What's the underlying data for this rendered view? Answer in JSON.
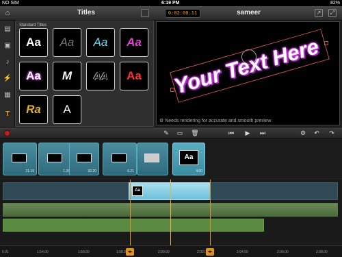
{
  "status": {
    "carrier": "NO SIM",
    "time": "6:19 PM",
    "battery": "82%"
  },
  "header": {
    "panel_title": "Titles",
    "timecode": "0:02:00.11",
    "project_name": "sameer"
  },
  "titles": {
    "section_label": "Standard Titles",
    "tiles": [
      {
        "label": "Aa",
        "color": "#ffffff",
        "style": "bold"
      },
      {
        "label": "Aa",
        "color": "#888888",
        "style": "script-outline"
      },
      {
        "label": "Aa",
        "color": "#6fd8f0",
        "style": "script"
      },
      {
        "label": "Aa",
        "color": "#e040d0",
        "style": "bold-italic"
      },
      {
        "label": "Aa",
        "color": "#ffffff",
        "style": "glow-magenta"
      },
      {
        "label": "M",
        "color": "#ffffff",
        "style": "swirl"
      },
      {
        "label": "AA",
        "color": "#555555",
        "style": "outline-3d"
      },
      {
        "label": "Aa",
        "color": "#ff3030",
        "style": "bold-red"
      },
      {
        "label": "Ra",
        "color": "#e0b030",
        "style": "gold"
      },
      {
        "label": "A",
        "color": "#ffffff",
        "style": "thin"
      }
    ]
  },
  "preview": {
    "text": "Your Text Here",
    "note": "Needs rendering for accurate and smooth preview",
    "text_color": "#ffffff",
    "glow_color": "#d040e0"
  },
  "clips": [
    {
      "duration": "21.19"
    },
    {
      "duration": "1.26"
    },
    {
      "duration": "32.20"
    },
    {
      "duration": "6.21"
    },
    {
      "duration": ""
    },
    {
      "duration": "4.00",
      "title_label": "Aa"
    }
  ],
  "timeline": {
    "title_clip_label": "Aa"
  },
  "ruler": {
    "ticks": [
      "0.01",
      "1:54.00",
      "1:56.00",
      "1:58.00",
      "2:00.00",
      "2:02.00",
      "2:04.00",
      "2:06.00",
      "2:08.00"
    ]
  },
  "colors": {
    "accent": "#e09020",
    "clip": "#3a8ca0",
    "audio": "#5a8a40"
  }
}
